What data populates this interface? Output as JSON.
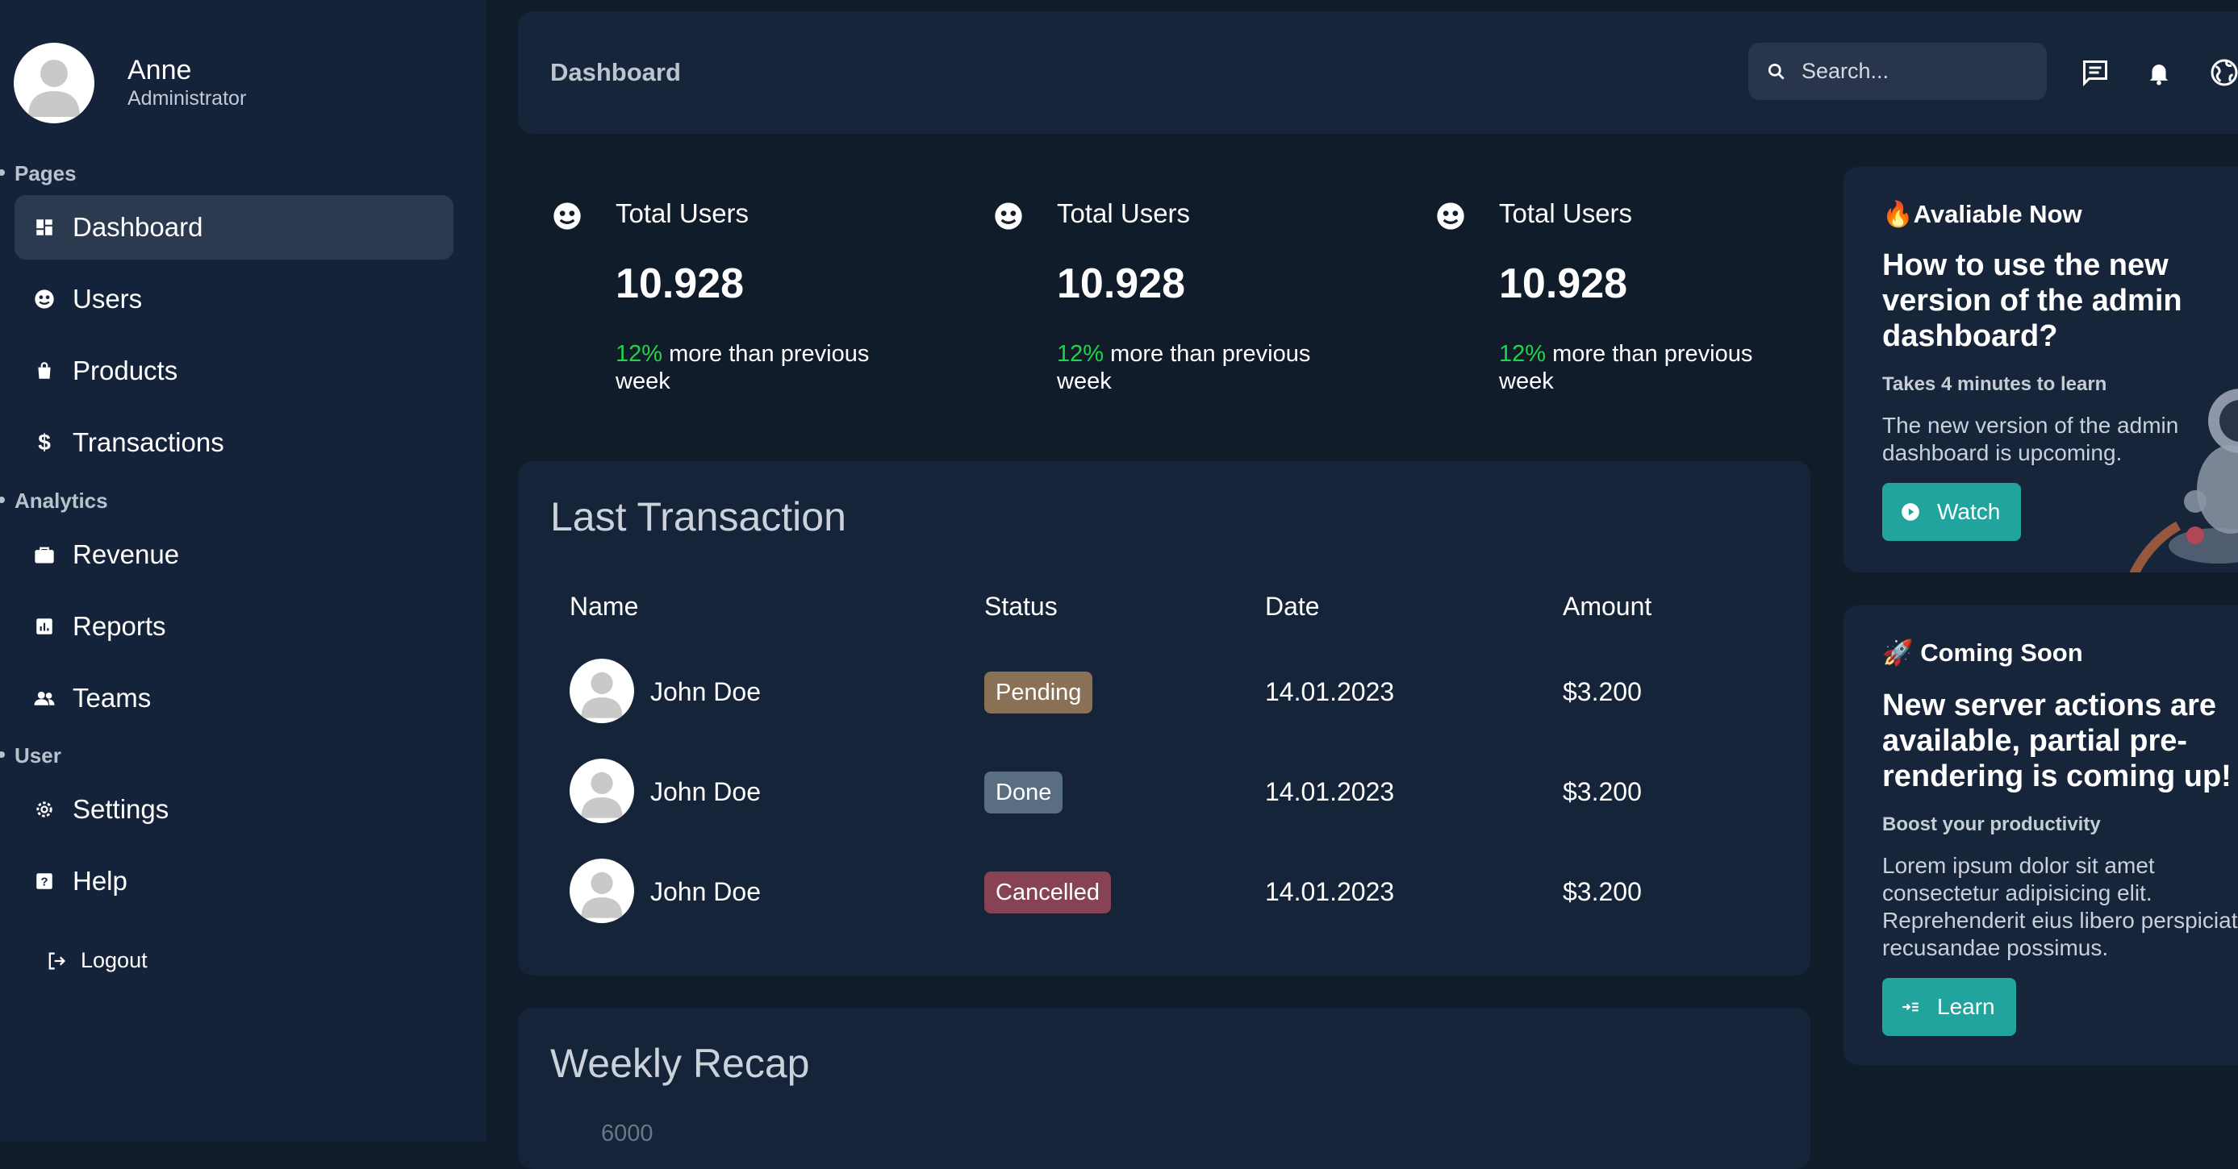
{
  "sidebar": {
    "user": {
      "name": "Anne",
      "role": "Administrator"
    },
    "sections": [
      {
        "title": "Pages",
        "items": [
          {
            "label": "Dashboard",
            "icon": "dashboard-icon",
            "active": true
          },
          {
            "label": "Users",
            "icon": "users-icon"
          },
          {
            "label": "Products",
            "icon": "bag-icon"
          },
          {
            "label": "Transactions",
            "icon": "dollar-icon"
          }
        ]
      },
      {
        "title": "Analytics",
        "items": [
          {
            "label": "Revenue",
            "icon": "briefcase-icon"
          },
          {
            "label": "Reports",
            "icon": "report-icon"
          },
          {
            "label": "Teams",
            "icon": "team-icon"
          }
        ]
      },
      {
        "title": "User",
        "items": [
          {
            "label": "Settings",
            "icon": "gear-icon"
          },
          {
            "label": "Help",
            "icon": "help-icon"
          }
        ]
      }
    ],
    "logout_label": "Logout"
  },
  "header": {
    "title": "Dashboard",
    "search_placeholder": "Search..."
  },
  "stats": [
    {
      "label": "Total Users",
      "value": "10.928",
      "percent": "12%",
      "note": " more than previous week"
    },
    {
      "label": "Total Users",
      "value": "10.928",
      "percent": "12%",
      "note": " more than previous week"
    },
    {
      "label": "Total Users",
      "value": "10.928",
      "percent": "12%",
      "note": " more than previous week"
    }
  ],
  "transactions": {
    "title": "Last Transaction",
    "columns": [
      "Name",
      "Status",
      "Date",
      "Amount"
    ],
    "rows": [
      {
        "name": "John Doe",
        "status": "Pending",
        "date": "14.01.2023",
        "amount": "$3.200"
      },
      {
        "name": "John Doe",
        "status": "Done",
        "date": "14.01.2023",
        "amount": "$3.200"
      },
      {
        "name": "John Doe",
        "status": "Cancelled",
        "date": "14.01.2023",
        "amount": "$3.200"
      }
    ],
    "status_colors": {
      "Pending": "#8a7155",
      "Done": "#5a6e82",
      "Cancelled": "#874253"
    }
  },
  "weekly": {
    "title": "Weekly Recap",
    "first_tick": "6000"
  },
  "promos": [
    {
      "tag": "🔥Avaliable Now",
      "title": "How to use the new version of the admin dashboard?",
      "subtitle": "Takes 4 minutes to learn",
      "text": "The new version of the admin dashboard is upcoming.",
      "button": "Watch"
    },
    {
      "tag": "🚀 Coming Soon",
      "title": "New server actions are available, partial pre-rendering is coming up!",
      "subtitle": "Boost your productivity",
      "text": "Lorem ipsum dolor sit amet consectetur adipisicing elit. Reprehenderit eius libero perspiciatis recusandae possimus.",
      "button": "Learn"
    }
  ],
  "colors": {
    "accent": "#21a39e",
    "positive": "#22d24a",
    "background": "#111c2b",
    "panel": "#16243a"
  }
}
